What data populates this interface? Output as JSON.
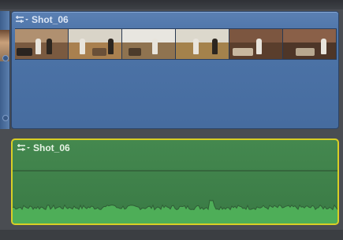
{
  "timeline": {
    "video_clip": {
      "name": "Shot_06"
    },
    "audio_clip": {
      "name": "Shot_06"
    }
  },
  "colors": {
    "video_clip": "#4d74a8",
    "audio_clip": "#3a7a45",
    "selection_outline": "#d9cf25",
    "waveform": "#55b35c"
  },
  "icons": {
    "clip_menu": "clip-options-icon"
  }
}
